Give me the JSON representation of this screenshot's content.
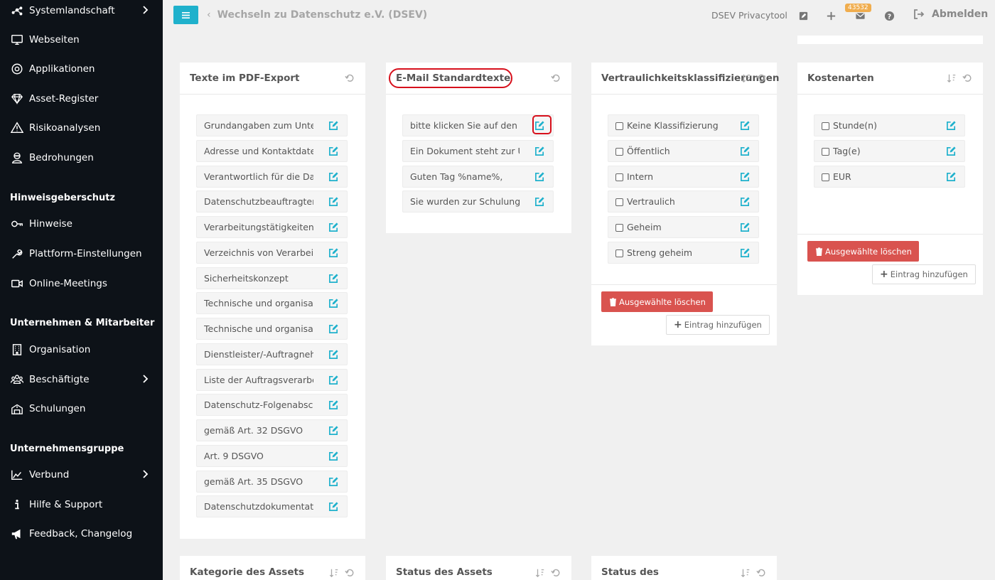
{
  "sidebar": {
    "items": [
      {
        "label": "Systemlandschaft",
        "icon": "network-icon",
        "chevron": true
      },
      {
        "label": "Webseiten",
        "icon": "monitor-icon"
      },
      {
        "label": "Applikationen",
        "icon": "target-icon"
      },
      {
        "label": "Asset-Register",
        "icon": "diamond-icon"
      },
      {
        "label": "Risikoanalysen",
        "icon": "warning-icon"
      },
      {
        "label": "Bedrohungen",
        "icon": "bandit-icon"
      },
      {
        "label": "Hinweise",
        "icon": "key-icon"
      },
      {
        "label": "Plattform-Einstellungen",
        "icon": "wrench-icon"
      },
      {
        "label": "Online-Meetings",
        "icon": "video-icon"
      },
      {
        "label": "Organisation",
        "icon": "building-icon"
      },
      {
        "label": "Beschäftigte",
        "icon": "users-icon",
        "chevron": true
      },
      {
        "label": "Schulungen",
        "icon": "school-icon"
      },
      {
        "label": "Verbund",
        "icon": "chart-icon",
        "chevron": true
      },
      {
        "label": "Hilfe & Support",
        "icon": "info-icon"
      },
      {
        "label": "Feedback, Changelog",
        "icon": "megaphone-icon"
      }
    ],
    "headers": [
      "Hinweisgeberschutz",
      "Unternehmen & Mitarbeiter",
      "Unternehmensgruppe"
    ]
  },
  "topbar": {
    "back_label": "Wechseln zu Datenschutz e.V. (DSEV)",
    "tool_name": "DSEV Privacytool",
    "mail_count": "43532",
    "logout_label": "Abmelden"
  },
  "cards": {
    "pdf": {
      "title": "Texte im PDF-Export",
      "items": [
        "Grundangaben zum Unternehmen",
        "Adresse und Kontaktdaten",
        "Verantwortlich für die Datenverarbeitung",
        "Datenschutzbeauftragter",
        "Verarbeitungstätigkeiten",
        "Verzeichnis von Verarbeitungstätigkeiten",
        "Sicherheitskonzept",
        "Technische und organisatorische Maßnahmen",
        "Technische und organisatorische Maßnahmen",
        "Dienstleister/-Auftragnehmer",
        "Liste der Auftragsverarbeiter",
        "Datenschutz-Folgenabschätzung",
        "gemäß Art. 32 DSGVO",
        "Art. 9 DSGVO",
        "gemäß Art. 35 DSGVO",
        "Datenschutzdokumentation"
      ]
    },
    "email": {
      "title": "E-Mail Standardtexte",
      "items": [
        "bitte klicken Sie auf den Link",
        "Ein Dokument steht zur Unterschrift",
        "Guten Tag %name%,",
        "Sie wurden zur Schulung eingeladen"
      ]
    },
    "conf": {
      "title": "Vertraulichkeitsklassifizierungen",
      "items": [
        "Keine Klassifizierung",
        "Öffentlich",
        "Intern",
        "Vertraulich",
        "Geheim",
        "Streng geheim"
      ],
      "delete_label": "Ausgewählte löschen",
      "add_label": "Eintrag hinzufügen"
    },
    "cost": {
      "title": "Kostenarten",
      "items": [
        "Stunde(n)",
        "Tag(e)",
        "EUR"
      ],
      "delete_label": "Ausgewählte löschen",
      "add_label": "Eintrag hinzufügen"
    },
    "assetcat": {
      "title": "Kategorie des Assets"
    },
    "assetstat": {
      "title": "Status des Assets"
    },
    "bizstat": {
      "title": "Status des"
    }
  },
  "colors": {
    "sidebar_bg": "#0d1218",
    "accent": "#1fb1cc",
    "danger": "#d9534f",
    "badge": "#f0ad4e",
    "highlight": "#d7101c"
  }
}
